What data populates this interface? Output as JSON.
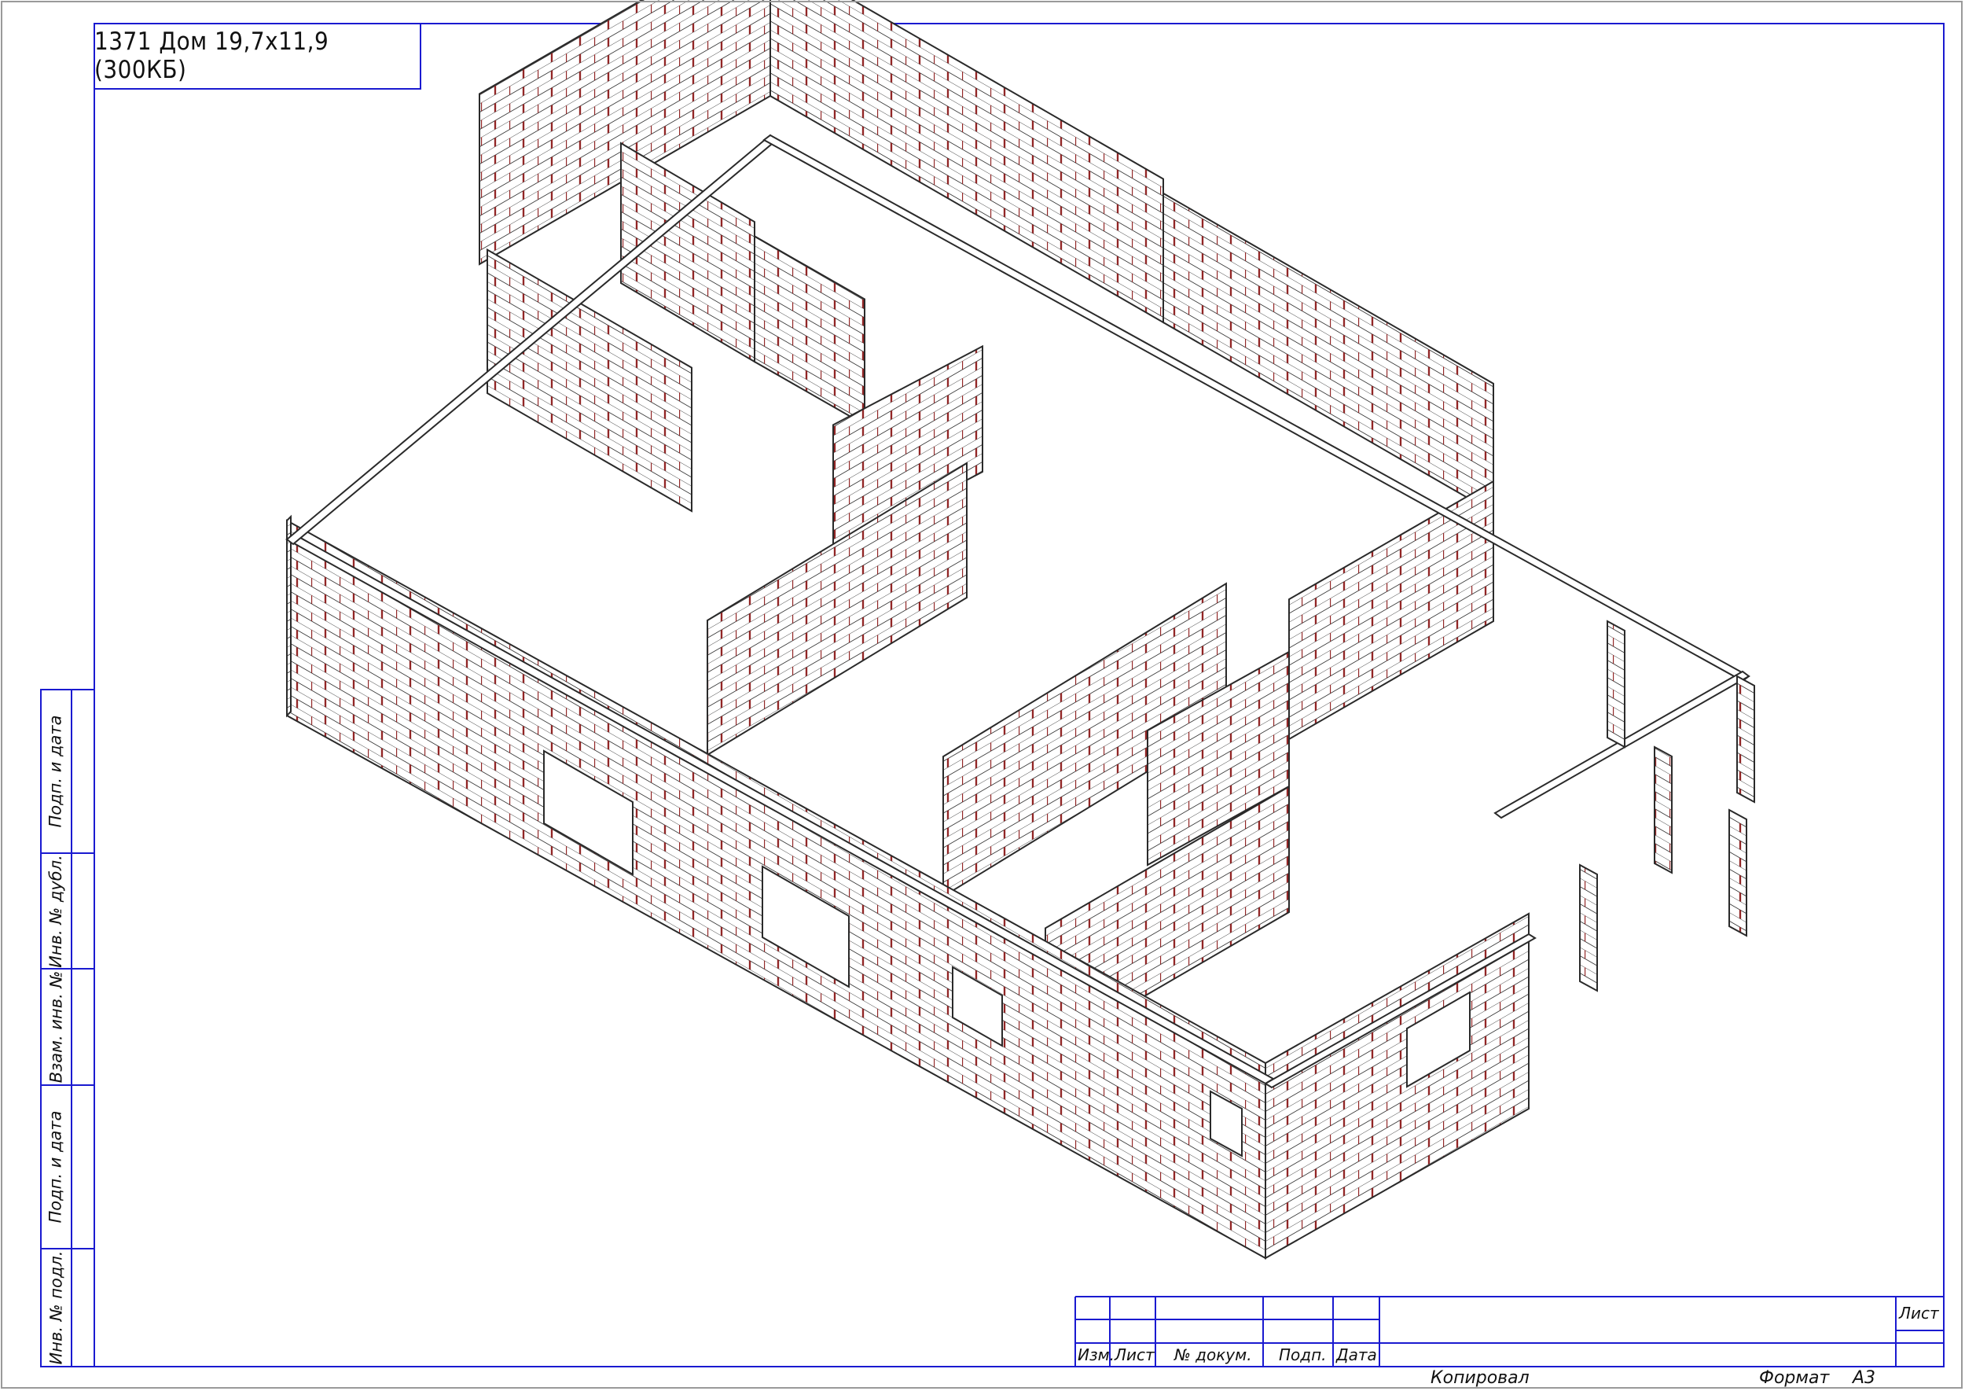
{
  "drawing": {
    "title": "1371 Дом 19,7х11,9 (300КБ)",
    "colors": {
      "frame": "#1a1ad0",
      "outline": "#2a2a2a",
      "brick_joint": "#8b1a1a",
      "paper": "#ffffff"
    }
  },
  "side_stamp": {
    "labels": [
      "Подп. и дата",
      "Инв. № дубл.",
      "Взам. инв. №",
      "Подп. и дата",
      "Инв. № подл."
    ]
  },
  "title_block": {
    "columns": [
      "Изм.",
      "Лист",
      "№ докум.",
      "Подп.",
      "Дата"
    ],
    "sheet_label": "Лист",
    "copied_label": "Копировал",
    "format_label": "Формат",
    "format_value": "А3"
  }
}
